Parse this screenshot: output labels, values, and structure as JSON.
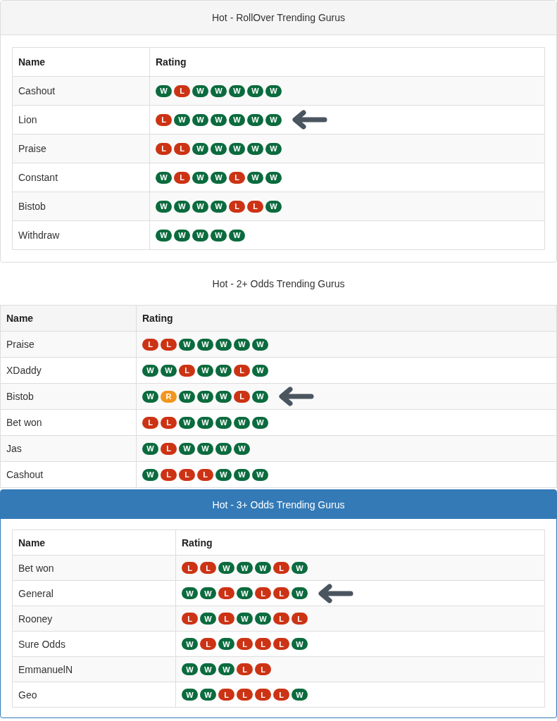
{
  "panels": [
    {
      "kind": "default",
      "title": "Hot - RollOver Trending Gurus",
      "columns": [
        "Name",
        "Rating"
      ],
      "rows": [
        {
          "name": "Cashout",
          "pointed": false,
          "badges": [
            {
              "label": "W",
              "color": "#0b6b3e"
            },
            {
              "label": "L",
              "color": "#cc3314"
            },
            {
              "label": "W",
              "color": "#0b6b3e"
            },
            {
              "label": "W",
              "color": "#0b6b3e"
            },
            {
              "label": "W",
              "color": "#0b6b3e"
            },
            {
              "label": "W",
              "color": "#0b6b3e"
            },
            {
              "label": "W",
              "color": "#0b6b3e"
            }
          ]
        },
        {
          "name": "Lion",
          "pointed": true,
          "badges": [
            {
              "label": "L",
              "color": "#cc3314"
            },
            {
              "label": "W",
              "color": "#0b6b3e"
            },
            {
              "label": "W",
              "color": "#0b6b3e"
            },
            {
              "label": "W",
              "color": "#0b6b3e"
            },
            {
              "label": "W",
              "color": "#0b6b3e"
            },
            {
              "label": "W",
              "color": "#0b6b3e"
            },
            {
              "label": "W",
              "color": "#0b6b3e"
            }
          ]
        },
        {
          "name": "Praise",
          "pointed": false,
          "badges": [
            {
              "label": "L",
              "color": "#cc3314"
            },
            {
              "label": "L",
              "color": "#cc3314"
            },
            {
              "label": "W",
              "color": "#0b6b3e"
            },
            {
              "label": "W",
              "color": "#0b6b3e"
            },
            {
              "label": "W",
              "color": "#0b6b3e"
            },
            {
              "label": "W",
              "color": "#0b6b3e"
            },
            {
              "label": "W",
              "color": "#0b6b3e"
            }
          ]
        },
        {
          "name": "Constant",
          "pointed": false,
          "badges": [
            {
              "label": "W",
              "color": "#0b6b3e"
            },
            {
              "label": "L",
              "color": "#cc3314"
            },
            {
              "label": "W",
              "color": "#0b6b3e"
            },
            {
              "label": "W",
              "color": "#0b6b3e"
            },
            {
              "label": "L",
              "color": "#cc3314"
            },
            {
              "label": "W",
              "color": "#0b6b3e"
            },
            {
              "label": "W",
              "color": "#0b6b3e"
            }
          ]
        },
        {
          "name": "Bistob",
          "pointed": false,
          "badges": [
            {
              "label": "W",
              "color": "#0b6b3e"
            },
            {
              "label": "W",
              "color": "#0b6b3e"
            },
            {
              "label": "W",
              "color": "#0b6b3e"
            },
            {
              "label": "W",
              "color": "#0b6b3e"
            },
            {
              "label": "L",
              "color": "#cc3314"
            },
            {
              "label": "L",
              "color": "#cc3314"
            },
            {
              "label": "W",
              "color": "#0b6b3e"
            }
          ]
        },
        {
          "name": "Withdraw",
          "pointed": false,
          "badges": [
            {
              "label": "W",
              "color": "#0b6b3e"
            },
            {
              "label": "W",
              "color": "#0b6b3e"
            },
            {
              "label": "W",
              "color": "#0b6b3e"
            },
            {
              "label": "W",
              "color": "#0b6b3e"
            },
            {
              "label": "W",
              "color": "#0b6b3e"
            }
          ]
        }
      ]
    },
    {
      "kind": "plain",
      "title": "Hot - 2+ Odds Trending Gurus",
      "columns": [
        "Name",
        "Rating"
      ],
      "rows": [
        {
          "name": "Praise",
          "pointed": false,
          "badges": [
            {
              "label": "L",
              "color": "#cc3314"
            },
            {
              "label": "L",
              "color": "#cc3314"
            },
            {
              "label": "W",
              "color": "#0b6b3e"
            },
            {
              "label": "W",
              "color": "#0b6b3e"
            },
            {
              "label": "W",
              "color": "#0b6b3e"
            },
            {
              "label": "W",
              "color": "#0b6b3e"
            },
            {
              "label": "W",
              "color": "#0b6b3e"
            }
          ]
        },
        {
          "name": "XDaddy",
          "pointed": false,
          "badges": [
            {
              "label": "W",
              "color": "#0b6b3e"
            },
            {
              "label": "W",
              "color": "#0b6b3e"
            },
            {
              "label": "L",
              "color": "#cc3314"
            },
            {
              "label": "W",
              "color": "#0b6b3e"
            },
            {
              "label": "W",
              "color": "#0b6b3e"
            },
            {
              "label": "L",
              "color": "#cc3314"
            },
            {
              "label": "W",
              "color": "#0b6b3e"
            }
          ]
        },
        {
          "name": "Bistob",
          "pointed": true,
          "badges": [
            {
              "label": "W",
              "color": "#0b6b3e"
            },
            {
              "label": "R",
              "color": "#f0961e"
            },
            {
              "label": "W",
              "color": "#0b6b3e"
            },
            {
              "label": "W",
              "color": "#0b6b3e"
            },
            {
              "label": "W",
              "color": "#0b6b3e"
            },
            {
              "label": "L",
              "color": "#cc3314"
            },
            {
              "label": "W",
              "color": "#0b6b3e"
            }
          ]
        },
        {
          "name": "Bet won",
          "pointed": false,
          "badges": [
            {
              "label": "L",
              "color": "#cc3314"
            },
            {
              "label": "L",
              "color": "#cc3314"
            },
            {
              "label": "W",
              "color": "#0b6b3e"
            },
            {
              "label": "W",
              "color": "#0b6b3e"
            },
            {
              "label": "W",
              "color": "#0b6b3e"
            },
            {
              "label": "W",
              "color": "#0b6b3e"
            },
            {
              "label": "W",
              "color": "#0b6b3e"
            }
          ]
        },
        {
          "name": "Jas",
          "pointed": false,
          "badges": [
            {
              "label": "W",
              "color": "#0b6b3e"
            },
            {
              "label": "L",
              "color": "#cc3314"
            },
            {
              "label": "W",
              "color": "#0b6b3e"
            },
            {
              "label": "W",
              "color": "#0b6b3e"
            },
            {
              "label": "W",
              "color": "#0b6b3e"
            },
            {
              "label": "W",
              "color": "#0b6b3e"
            }
          ]
        },
        {
          "name": "Cashout",
          "pointed": false,
          "badges": [
            {
              "label": "W",
              "color": "#0b6b3e"
            },
            {
              "label": "L",
              "color": "#cc3314"
            },
            {
              "label": "L",
              "color": "#cc3314"
            },
            {
              "label": "L",
              "color": "#cc3314"
            },
            {
              "label": "W",
              "color": "#0b6b3e"
            },
            {
              "label": "W",
              "color": "#0b6b3e"
            },
            {
              "label": "W",
              "color": "#0b6b3e"
            }
          ]
        }
      ]
    },
    {
      "kind": "primary",
      "title": "Hot - 3+ Odds Trending Gurus",
      "columns": [
        "Name",
        "Rating"
      ],
      "rows": [
        {
          "name": "Bet won",
          "pointed": false,
          "badges": [
            {
              "label": "L",
              "color": "#cc3314"
            },
            {
              "label": "L",
              "color": "#cc3314"
            },
            {
              "label": "W",
              "color": "#0b6b3e"
            },
            {
              "label": "W",
              "color": "#0b6b3e"
            },
            {
              "label": "W",
              "color": "#0b6b3e"
            },
            {
              "label": "L",
              "color": "#cc3314"
            },
            {
              "label": "W",
              "color": "#0b6b3e"
            }
          ]
        },
        {
          "name": "General",
          "pointed": true,
          "badges": [
            {
              "label": "W",
              "color": "#0b6b3e"
            },
            {
              "label": "W",
              "color": "#0b6b3e"
            },
            {
              "label": "L",
              "color": "#cc3314"
            },
            {
              "label": "W",
              "color": "#0b6b3e"
            },
            {
              "label": "L",
              "color": "#cc3314"
            },
            {
              "label": "L",
              "color": "#cc3314"
            },
            {
              "label": "W",
              "color": "#0b6b3e"
            }
          ]
        },
        {
          "name": "Rooney",
          "pointed": false,
          "badges": [
            {
              "label": "L",
              "color": "#cc3314"
            },
            {
              "label": "W",
              "color": "#0b6b3e"
            },
            {
              "label": "L",
              "color": "#cc3314"
            },
            {
              "label": "W",
              "color": "#0b6b3e"
            },
            {
              "label": "W",
              "color": "#0b6b3e"
            },
            {
              "label": "L",
              "color": "#cc3314"
            },
            {
              "label": "L",
              "color": "#cc3314"
            }
          ]
        },
        {
          "name": "Sure Odds",
          "pointed": false,
          "badges": [
            {
              "label": "W",
              "color": "#0b6b3e"
            },
            {
              "label": "L",
              "color": "#cc3314"
            },
            {
              "label": "W",
              "color": "#0b6b3e"
            },
            {
              "label": "L",
              "color": "#cc3314"
            },
            {
              "label": "L",
              "color": "#cc3314"
            },
            {
              "label": "L",
              "color": "#cc3314"
            },
            {
              "label": "W",
              "color": "#0b6b3e"
            }
          ]
        },
        {
          "name": "EmmanuelN",
          "pointed": false,
          "badges": [
            {
              "label": "W",
              "color": "#0b6b3e"
            },
            {
              "label": "W",
              "color": "#0b6b3e"
            },
            {
              "label": "W",
              "color": "#0b6b3e"
            },
            {
              "label": "L",
              "color": "#cc3314"
            },
            {
              "label": "L",
              "color": "#cc3314"
            }
          ]
        },
        {
          "name": "Geo",
          "pointed": false,
          "badges": [
            {
              "label": "W",
              "color": "#0b6b3e"
            },
            {
              "label": "W",
              "color": "#0b6b3e"
            },
            {
              "label": "L",
              "color": "#cc3314"
            },
            {
              "label": "L",
              "color": "#cc3314"
            },
            {
              "label": "L",
              "color": "#cc3314"
            },
            {
              "label": "L",
              "color": "#cc3314"
            },
            {
              "label": "W",
              "color": "#0b6b3e"
            }
          ]
        }
      ]
    }
  ]
}
